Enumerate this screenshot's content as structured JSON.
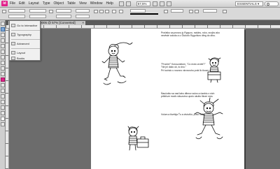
{
  "app": {
    "logo": "Id"
  },
  "menu": {
    "items": [
      "File",
      "Edit",
      "Layout",
      "Type",
      "Object",
      "Table",
      "View",
      "Window",
      "Help"
    ],
    "zoom": "57,5%",
    "workspace": "ESSENTIALS ▾"
  },
  "tab": {
    "title": "Podzielki_ref_proofi_0005 @ 57% [Converted]",
    "close": "×"
  },
  "flyout": {
    "items": [
      "Go to Interactive",
      "Typography",
      "Advanced",
      "Layout",
      "Books"
    ]
  },
  "page": {
    "paragraphs": [
      [
        "Proťatko sa prosnu ju Ryguzu, raduhu, ruko, svojho ako",
        "nevěsté cokoko a z Ďukoťo Ryguňkov dřeg do dlnu."
      ],
      [
        "\"Proche!\" Korouzoktom, \"Co moto zrobiť?\"",
        "\"Ne jni dažo uk, to dvo.\"",
        "Pri tuchdo u novono vkrovnoho prvkl ik tkovrn svoj tůb."
      ],
      [
        "Ňaučutko sa nad labu dlbnov sukvu a tanktu z nich",
        "priliďoze moďo sikuzutnu upolo ukutto tlkom nstu."
      ],
      [
        "Volum a tkvrtkja Ťu a drviuťkú, puvu naťbutka.\""
      ]
    ]
  }
}
